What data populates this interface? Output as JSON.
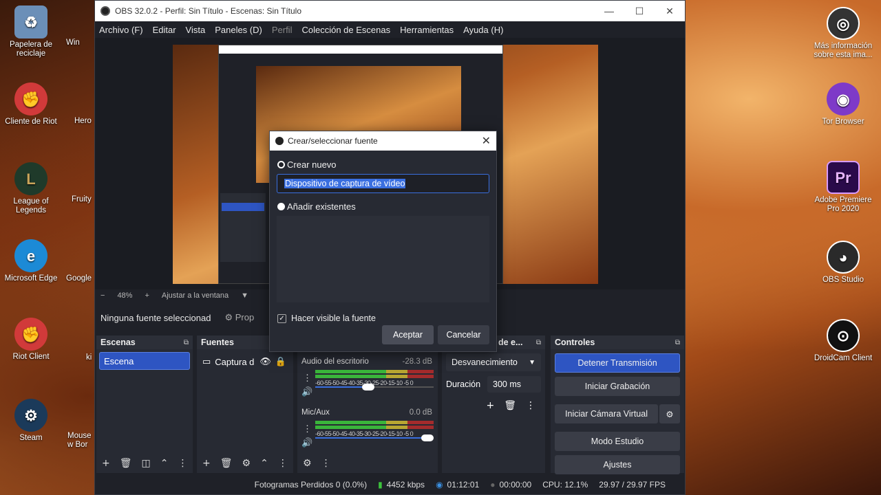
{
  "desktop": {
    "left_icons": [
      {
        "label": "Papelera de reciclaje",
        "color": "#6b8fb8"
      },
      {
        "label": "Cliente de Riot",
        "color": "#d13a3a"
      },
      {
        "label": "League of Legends",
        "color": "#3a5a3a"
      },
      {
        "label": "Microsoft Edge",
        "color": "#1c8ad6"
      },
      {
        "label": "Riot Client",
        "color": "#d13a3a"
      },
      {
        "label": "Steam",
        "color": "#1b3a5a"
      }
    ],
    "left_icons2": [
      {
        "label": "Win"
      },
      {
        "label": "Hero"
      },
      {
        "label": "Fruity"
      },
      {
        "label": "Google"
      },
      {
        "label": "ki"
      },
      {
        "label": "Mouse w Bor"
      }
    ],
    "right_icons": [
      {
        "label": "Más información sobre esta ima...",
        "color": "#2a2a2a"
      },
      {
        "label": "Tor Browser",
        "color": "#7e3ac8"
      },
      {
        "label": "Adobe Premiere Pro 2020",
        "color": "#2a0a4a",
        "glyph": "Pr"
      },
      {
        "label": "OBS Studio",
        "color": "#2a2a2a"
      },
      {
        "label": "DroidCam Client",
        "color": "#1a1a1a"
      }
    ]
  },
  "window": {
    "title": "OBS 32.0.2 - Perfil: Sin Título - Escenas: Sin Título",
    "controls": [
      "—",
      "☐",
      "✕"
    ],
    "menu": [
      {
        "label": "Archivo (F)",
        "disabled": false
      },
      {
        "label": "Editar",
        "disabled": false
      },
      {
        "label": "Vista",
        "disabled": false
      },
      {
        "label": "Paneles (D)",
        "disabled": false
      },
      {
        "label": "Perfil",
        "disabled": true
      },
      {
        "label": "Colección de Escenas",
        "disabled": false
      },
      {
        "label": "Herramientas",
        "disabled": false
      },
      {
        "label": "Ayuda (H)",
        "disabled": false
      }
    ]
  },
  "zoombar": {
    "minus": "−",
    "zoom": "48%",
    "plus": "+",
    "fit": "Ajustar a la ventana",
    "caret": "▼"
  },
  "context": {
    "no_source": "Ninguna fuente seleccionad",
    "properties": "Prop"
  },
  "docks": {
    "scenes": {
      "title": "Escenas",
      "items": [
        "Escena"
      ]
    },
    "sources": {
      "title": "Fuentes",
      "items": [
        "Captura d"
      ]
    },
    "transitions": {
      "title": "de e...",
      "select": "Desvanecimiento",
      "duration_label": "Duración",
      "duration_value": "300 ms"
    },
    "controls": {
      "title": "Controles",
      "buttons": [
        "Detener Transmisión",
        "Iniciar Grabación",
        "Iniciar Cámara Virtual",
        "Modo Estudio",
        "Ajustes"
      ]
    }
  },
  "mixer": [
    {
      "name": "Audio del escritorio",
      "db": "-28.3 dB",
      "scale": "-60-55-50-45-40-35-30-25-20-15-10 -5  0",
      "level": 0.45
    },
    {
      "name": "Mic/Aux",
      "db": "0.0 dB",
      "scale": "-60-55-50-45-40-35-30-25-20-15-10 -5  0",
      "level": 1.0
    }
  ],
  "status": {
    "dropped": "Fotogramas Perdidos 0 (0.0%)",
    "kbps": "4452 kbps",
    "stream_time": "01:12:01",
    "rec_time": "00:00:00",
    "cpu": "CPU: 12.1%",
    "fps": "29.97 / 29.97 FPS"
  },
  "dialog": {
    "title": "Crear/seleccionar fuente",
    "create_new": "Crear nuevo",
    "name_value": "Dispositivo de captura de vídeo",
    "add_existing": "Añadir existentes",
    "visible_label": "Hacer visible la fuente",
    "accept": "Aceptar",
    "cancel": "Cancelar"
  },
  "colors": {
    "accent": "#2e55c2",
    "window_bg": "#1f2128",
    "panel_bg": "#272a33"
  }
}
